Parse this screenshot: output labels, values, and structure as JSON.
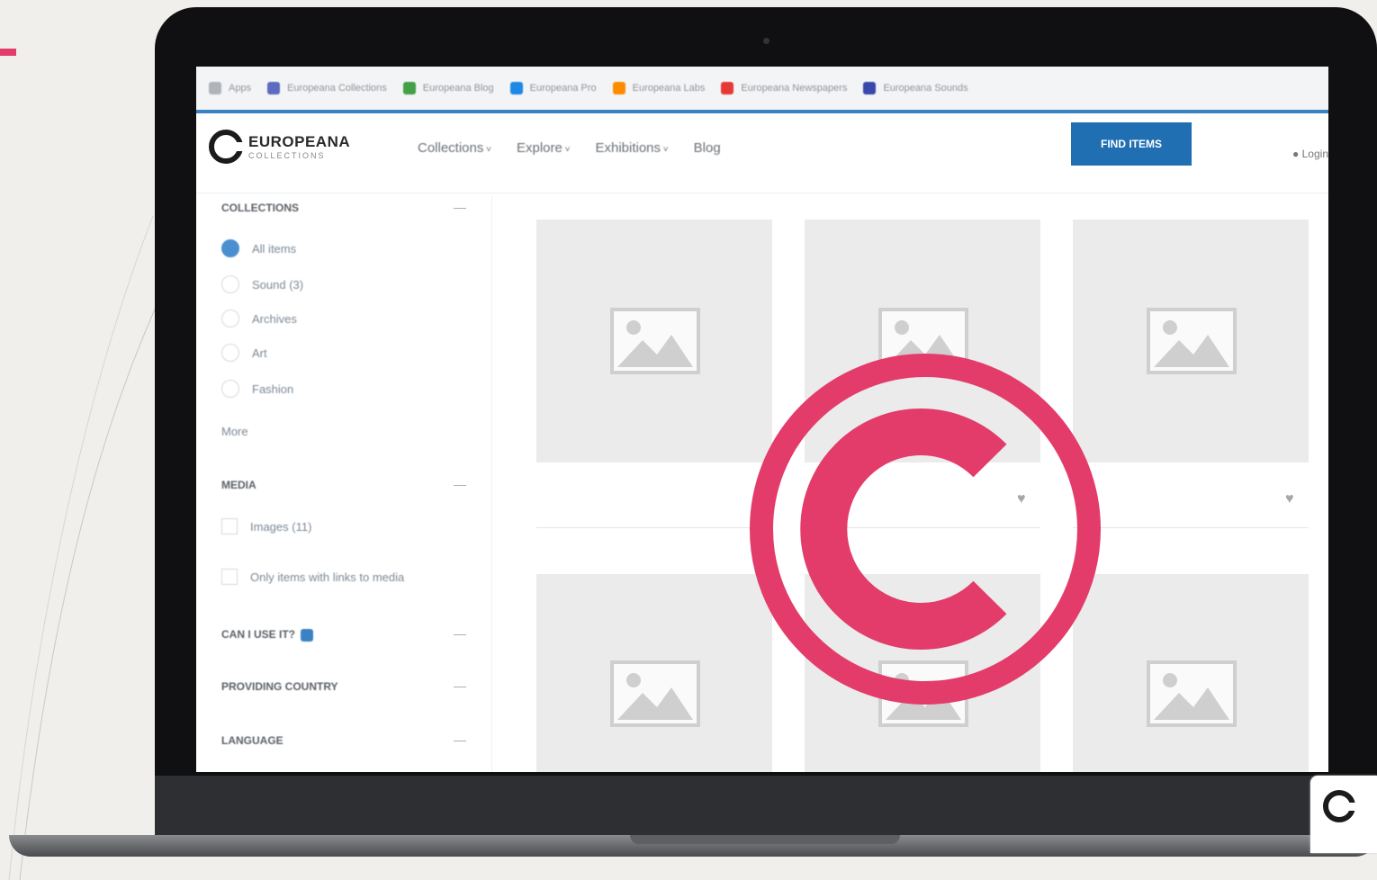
{
  "bookmarks": [
    {
      "label": "Apps",
      "icon": "apps-icon",
      "color": "#b0b4b8"
    },
    {
      "label": "Europeana Collections",
      "icon": "bookmark-icon",
      "color": "#5c6bc0"
    },
    {
      "label": "Europeana Blog",
      "icon": "bookmark-icon",
      "color": "#43a047"
    },
    {
      "label": "Europeana Pro",
      "icon": "bookmark-icon",
      "color": "#1e88e5"
    },
    {
      "label": "Europeana Labs",
      "icon": "bookmark-icon",
      "color": "#fb8c00"
    },
    {
      "label": "Europeana Newspapers",
      "icon": "bookmark-icon",
      "color": "#e53935"
    },
    {
      "label": "Europeana Sounds",
      "icon": "bookmark-icon",
      "color": "#3949ab"
    }
  ],
  "header": {
    "logo_name": "EUROPEANA",
    "logo_sub": "COLLECTIONS",
    "nav": [
      "Collections",
      "Explore",
      "Exhibitions",
      "Blog"
    ],
    "find_button": "FIND ITEMS",
    "user": "Login"
  },
  "sidebar": {
    "collections_title": "COLLECTIONS",
    "collection_items": [
      "All items",
      "Sound (3)",
      "Archives",
      "Art",
      "Fashion"
    ],
    "more_label": "More",
    "media_title": "MEDIA",
    "media_items": [
      "Images (11)",
      "Only items with links to media"
    ],
    "reuse_title": "CAN I USE IT?",
    "providing_title": "PROVIDING COUNTRY",
    "language_title": "LANGUAGE"
  },
  "colors": {
    "accent": "#e33b6a",
    "primary_button": "#1f6fb2",
    "selected_radio": "#4a8fd0"
  }
}
